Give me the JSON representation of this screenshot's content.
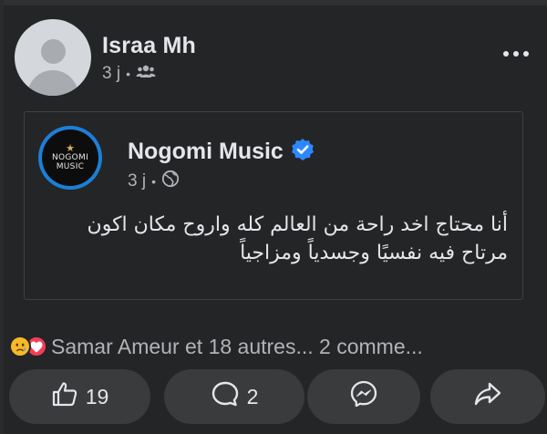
{
  "post": {
    "author_name": "Israa Mh",
    "time": "3 j",
    "audience_icon": "friends-icon"
  },
  "shared": {
    "page_name": "Nogomi Music",
    "verified_icon": "verified-badge-icon",
    "logo_text_line1": "NOGOMI",
    "logo_text_line2": "MUSIC",
    "time": "3 j",
    "audience_icon": "globe-icon",
    "text": "أنا محتاج اخد راحة من العالم كله واروح مكان اكون مرتاح فيه نفسيًا وجسدياً ومزاجياً"
  },
  "reactions": {
    "icons": [
      "sad-reaction-icon",
      "love-reaction-icon"
    ],
    "summary": "Samar Ameur et 18 autres... 2 comme..."
  },
  "actions": {
    "like_count": "19",
    "comment_count": "2"
  },
  "colors": {
    "background": "#242526",
    "button_bg": "#3a3b3c",
    "text_primary": "#e4e6eb",
    "text_secondary": "#b0b3b8",
    "verified_blue": "#2d88ff",
    "logo_ring": "#1c7fd6"
  }
}
